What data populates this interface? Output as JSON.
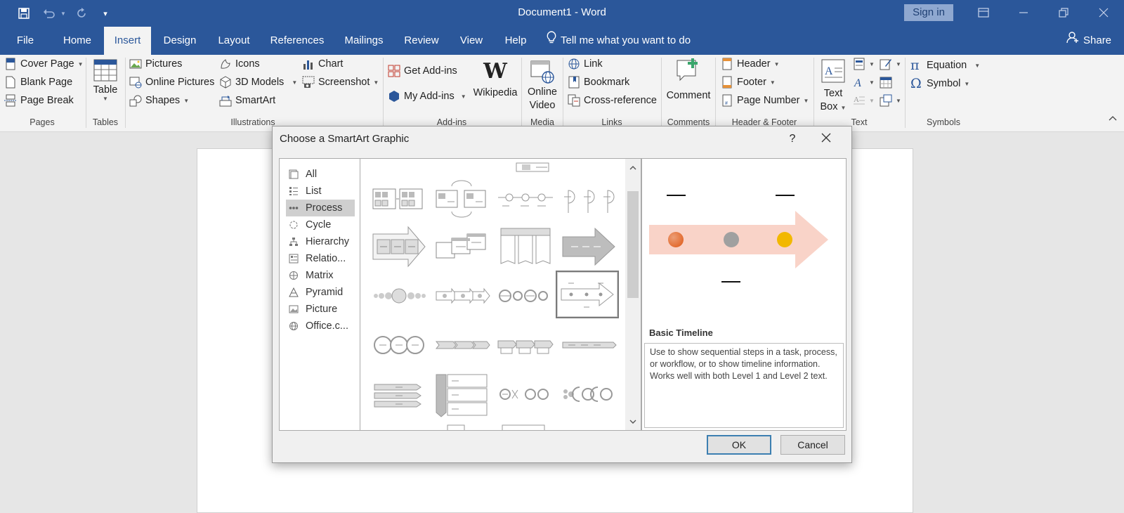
{
  "titlebar": {
    "doc_title": "Document1  -  Word",
    "sign_in": "Sign in"
  },
  "tabs": [
    "File",
    "Home",
    "Insert",
    "Design",
    "Layout",
    "References",
    "Mailings",
    "Review",
    "View",
    "Help"
  ],
  "active_tab": "Insert",
  "tell_me": "Tell me what you want to do",
  "share": "Share",
  "ribbon": {
    "pages": {
      "items": [
        "Cover Page",
        "Blank Page",
        "Page Break"
      ],
      "label": "Pages"
    },
    "tables": {
      "table": "Table",
      "label": "Tables"
    },
    "illustrations": {
      "pictures": "Pictures",
      "online_pictures": "Online Pictures",
      "shapes": "Shapes",
      "icons": "Icons",
      "models": "3D Models",
      "smartart": "SmartArt",
      "chart": "Chart",
      "screenshot": "Screenshot",
      "label": "Illustrations"
    },
    "addins": {
      "get": "Get Add-ins",
      "my": "My Add-ins",
      "wikipedia": "Wikipedia",
      "label": "Add-ins"
    },
    "media": {
      "online": "Online",
      "video": "Video",
      "label": "Media"
    },
    "links": {
      "link": "Link",
      "bookmark": "Bookmark",
      "cross": "Cross-reference",
      "label": "Links"
    },
    "comments": {
      "comment": "Comment",
      "label": "Comments"
    },
    "header_footer": {
      "header": "Header",
      "footer": "Footer",
      "page_number": "Page Number",
      "label": "Header & Footer"
    },
    "text": {
      "text": "Text",
      "box": "Box",
      "label": "Text"
    },
    "symbols": {
      "equation": "Equation",
      "symbol": "Symbol",
      "label": "Symbols"
    }
  },
  "dialog": {
    "title": "Choose a SmartArt Graphic",
    "help": "?",
    "categories": [
      "All",
      "List",
      "Process",
      "Cycle",
      "Hierarchy",
      "Relatio...",
      "Matrix",
      "Pyramid",
      "Picture",
      "Office.c..."
    ],
    "selected_category": "Process",
    "preview": {
      "name": "Basic Timeline",
      "description": "Use to show sequential steps in a task, process, or workflow, or to show timeline information. Works well with both Level 1 and Level 2 text."
    },
    "ok": "OK",
    "cancel": "Cancel"
  },
  "colors": {
    "brand": "#2b579a",
    "timeline_arrow": "#f9d3c8",
    "dot1": "#e2692c",
    "dot2": "#a0a0a0",
    "dot3": "#f2b800"
  }
}
